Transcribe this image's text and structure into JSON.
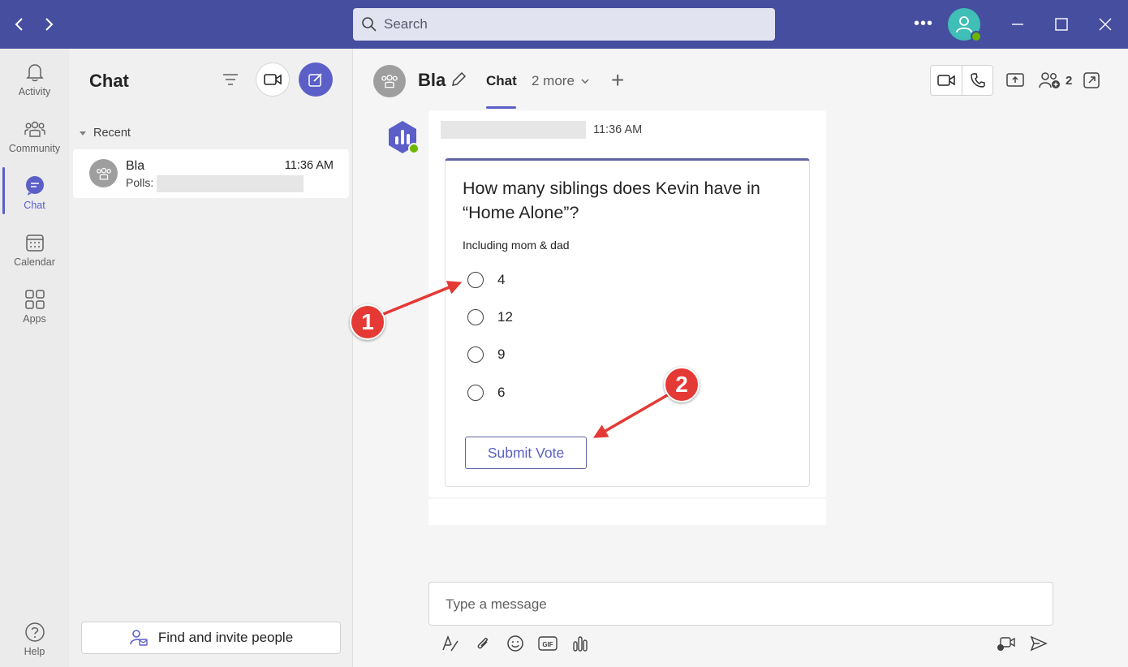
{
  "titlebar": {
    "search_placeholder": "Search"
  },
  "rail": {
    "items": [
      {
        "label": "Activity",
        "icon": "bell-icon"
      },
      {
        "label": "Community",
        "icon": "community-icon"
      },
      {
        "label": "Chat",
        "icon": "chat-icon",
        "active": true
      },
      {
        "label": "Calendar",
        "icon": "calendar-icon"
      },
      {
        "label": "Apps",
        "icon": "apps-icon"
      }
    ],
    "help_label": "Help"
  },
  "chatlist": {
    "title": "Chat",
    "section_label": "Recent",
    "items": [
      {
        "name": "Bla",
        "time": "11:36 AM",
        "preview_prefix": "Polls:"
      }
    ],
    "find_button_label": "Find and invite people"
  },
  "conversation": {
    "name": "Bla",
    "tab_active": "Chat",
    "tab_more": "2 more",
    "participants_count": "2",
    "message": {
      "time": "11:36 AM",
      "poll": {
        "question": "How many siblings does Kevin have in “Home Alone”?",
        "subtitle": "Including mom & dad",
        "options": [
          "4",
          "12",
          "9",
          "6"
        ],
        "submit_label": "Submit Vote"
      }
    },
    "compose_placeholder": "Type a message"
  },
  "annotations": {
    "badge_1": "1",
    "badge_2": "2"
  },
  "colors": {
    "titlebar": "#464ea0",
    "accent": "#5b5fc7",
    "annotation": "#e53935",
    "presence": "#6bb700"
  }
}
